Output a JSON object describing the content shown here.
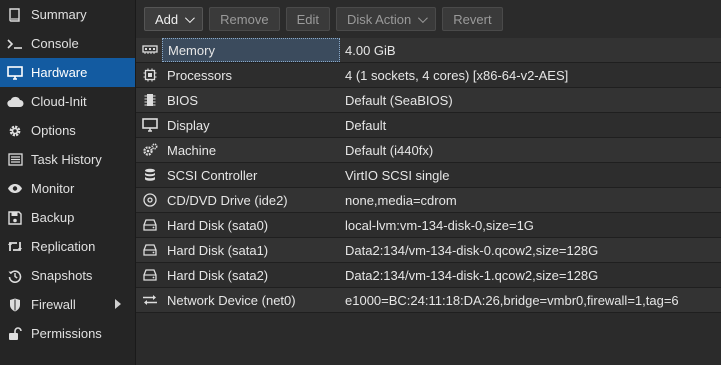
{
  "sidebar": {
    "items": [
      {
        "label": "Summary",
        "icon": "book-icon"
      },
      {
        "label": "Console",
        "icon": "terminal-icon"
      },
      {
        "label": "Hardware",
        "icon": "desktop-icon",
        "active": true
      },
      {
        "label": "Cloud-Init",
        "icon": "cloud-icon"
      },
      {
        "label": "Options",
        "icon": "gear-icon"
      },
      {
        "label": "Task History",
        "icon": "list-icon"
      },
      {
        "label": "Monitor",
        "icon": "eye-icon"
      },
      {
        "label": "Backup",
        "icon": "floppy-icon"
      },
      {
        "label": "Replication",
        "icon": "retweet-icon"
      },
      {
        "label": "Snapshots",
        "icon": "history-icon"
      },
      {
        "label": "Firewall",
        "icon": "shield-icon",
        "has_submenu": true
      },
      {
        "label": "Permissions",
        "icon": "unlock-icon"
      }
    ]
  },
  "toolbar": {
    "add_label": "Add",
    "remove_label": "Remove",
    "edit_label": "Edit",
    "disk_action_label": "Disk Action",
    "revert_label": "Revert"
  },
  "hardware": {
    "rows": [
      {
        "name": "Memory",
        "value": "4.00 GiB",
        "icon": "memory-icon"
      },
      {
        "name": "Processors",
        "value": "4 (1 sockets, 4 cores) [x86-64-v2-AES]",
        "icon": "cpu-icon"
      },
      {
        "name": "BIOS",
        "value": "Default (SeaBIOS)",
        "icon": "microchip-icon"
      },
      {
        "name": "Display",
        "value": "Default",
        "icon": "monitor-icon"
      },
      {
        "name": "Machine",
        "value": "Default (i440fx)",
        "icon": "cogs-icon"
      },
      {
        "name": "SCSI Controller",
        "value": "VirtIO SCSI single",
        "icon": "database-icon"
      },
      {
        "name": "CD/DVD Drive (ide2)",
        "value": "none,media=cdrom",
        "icon": "cdrom-icon"
      },
      {
        "name": "Hard Disk (sata0)",
        "value": "local-lvm:vm-134-disk-0,size=1G",
        "icon": "hdd-icon"
      },
      {
        "name": "Hard Disk (sata1)",
        "value": "Data2:134/vm-134-disk-0.qcow2,size=128G",
        "icon": "hdd-icon"
      },
      {
        "name": "Hard Disk (sata2)",
        "value": "Data2:134/vm-134-disk-1.qcow2,size=128G",
        "icon": "hdd-icon"
      },
      {
        "name": "Network Device (net0)",
        "value": "e1000=BC:24:11:18:DA:26,bridge=vmbr0,firewall=1,tag=6",
        "icon": "exchange-icon"
      }
    ]
  },
  "colors": {
    "accent": "#135ba1",
    "background": "#2b2b2b",
    "sidebar": "#252525"
  }
}
